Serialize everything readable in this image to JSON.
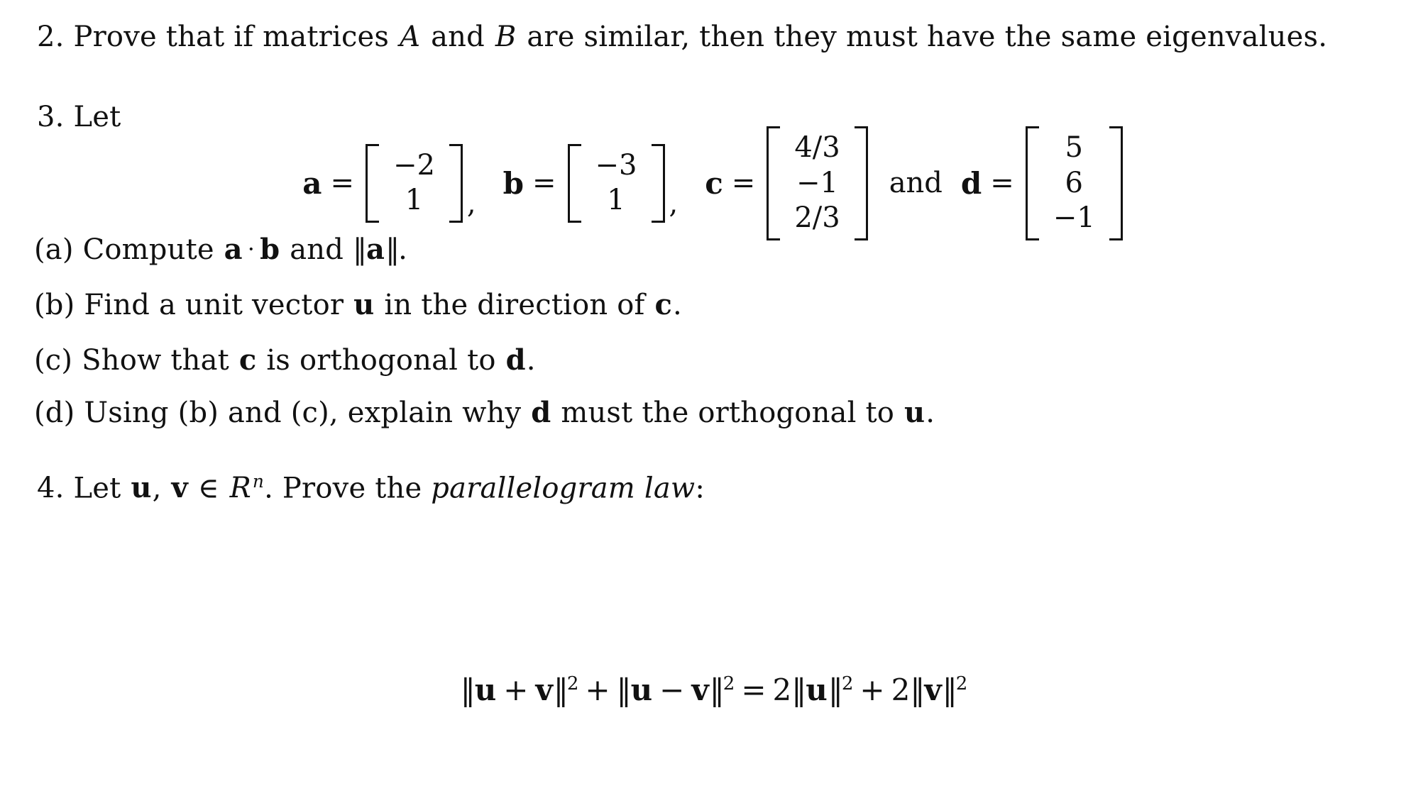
{
  "document": {
    "type": "math-problem-set",
    "background_color": "#ffffff",
    "text_color": "#111111"
  },
  "problem2": {
    "number": "2.",
    "text_part1": "Prove that if matrices",
    "var_A": "A",
    "text_part2": "and",
    "var_B": "B",
    "text_part3": "are similar, then they must have the same eigenvalues."
  },
  "problem3": {
    "number": "3.",
    "lead": "Let",
    "vectors": [
      {
        "name": "a",
        "equals": "=",
        "entries": [
          "−2",
          "1"
        ],
        "separator": ","
      },
      {
        "name": "b",
        "equals": "=",
        "entries": [
          "−3",
          "1"
        ],
        "separator": ","
      },
      {
        "name": "c",
        "equals": "=",
        "entries": [
          "4/3",
          "−1",
          "2/3"
        ],
        "separator": ""
      },
      {
        "name": "d",
        "equals": "=",
        "entries": [
          "5",
          "6",
          "−1"
        ],
        "separator": ""
      }
    ],
    "conjunction": "and",
    "items": [
      {
        "label": "(a)",
        "seg1": "Compute",
        "v1": "a",
        "dot": "·",
        "v2": "b",
        "seg2": "and",
        "norm_open": "‖",
        "v3": "a",
        "norm_close": "‖",
        "seg3": "."
      },
      {
        "label": "(b)",
        "seg1": "Find a unit vector",
        "v1": "u",
        "seg2": "in the direction of",
        "v2": "c",
        "seg3": "."
      },
      {
        "label": "(c)",
        "seg1": "Show that",
        "v1": "c",
        "seg2": "is orthogonal to",
        "v2": "d",
        "seg3": "."
      },
      {
        "label": "(d)",
        "seg1": "Using (b) and (c), explain why",
        "v1": "d",
        "seg2": "must the orthogonal to",
        "v2": "u",
        "seg3": "."
      }
    ]
  },
  "problem4": {
    "number": "4.",
    "seg1": "Let",
    "v1": "u",
    "comma": ",",
    "v2": "v",
    "member": "∈",
    "space_R": "R",
    "space_exp": "n",
    "seg2": ". Prove the",
    "emph": "parallelogram law",
    "seg3": ":",
    "equation": {
      "lhs_norm1_open": "‖",
      "lhs_u1": "u",
      "lhs_plus": "+",
      "lhs_v1": "v",
      "lhs_norm1_close": "‖",
      "exp1": "2",
      "mid_plus": "+",
      "lhs_norm2_open": "‖",
      "lhs_u2": "u",
      "lhs_minus": "−",
      "lhs_v2": "v",
      "lhs_norm2_close": "‖",
      "exp2": "2",
      "equals": "=",
      "coef1": "2",
      "rhs_norm1_open": "‖",
      "rhs_u": "u",
      "rhs_norm1_close": "‖",
      "exp3": "2",
      "rhs_plus": "+",
      "coef2": "2",
      "rhs_norm2_open": "‖",
      "rhs_v": "v",
      "rhs_norm2_close": "‖",
      "exp4": "2"
    }
  }
}
